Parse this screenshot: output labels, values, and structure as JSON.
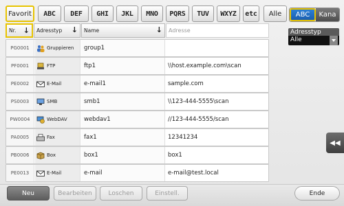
{
  "filter": {
    "tabs": [
      "Favorit",
      "ABC",
      "DEF",
      "GHI",
      "JKL",
      "MNO",
      "PQRS",
      "TUV",
      "WXYZ",
      "etc",
      "Alle"
    ],
    "active_tab": "Favorit"
  },
  "mode_toggle": {
    "abc": "ABC",
    "kana": "Kana",
    "selected": "ABC"
  },
  "address_type_filter": {
    "label": "Adresstyp",
    "value": "Alle"
  },
  "table": {
    "columns": {
      "nr": "Nr.",
      "type": "Adresstyp",
      "name": "Name",
      "address": "Adresse"
    },
    "rows": [
      {
        "nr": "PG0001",
        "type": "Gruppieren",
        "icon": "group-icon",
        "name": "group1",
        "address": ""
      },
      {
        "nr": "PF0001",
        "type": "FTP",
        "icon": "ftp-icon",
        "name": "ftp1",
        "address": "\\\\host.example.com\\scan"
      },
      {
        "nr": "PE0002",
        "type": "E-Mail",
        "icon": "email-icon",
        "name": "e-mail1",
        "address": "sample.com"
      },
      {
        "nr": "PS0003",
        "type": "SMB",
        "icon": "smb-icon",
        "name": "smb1",
        "address": "\\\\123-444-5555\\scan"
      },
      {
        "nr": "PW0004",
        "type": "WebDAV",
        "icon": "webdav-icon",
        "name": "webdav1",
        "address": "//123-444-5555/scan"
      },
      {
        "nr": "PA0005",
        "type": "Fax",
        "icon": "fax-icon",
        "name": "fax1",
        "address": "12341234"
      },
      {
        "nr": "PB0006",
        "type": "Box",
        "icon": "box-icon",
        "name": "box1",
        "address": "box1"
      },
      {
        "nr": "PE0013",
        "type": "E-Mail",
        "icon": "email-icon",
        "name": "e-mail",
        "address": "e-mail@test.local"
      }
    ]
  },
  "buttons": {
    "new": "Neu",
    "edit": "Bearbeiten",
    "delete": "Loschen",
    "settings": "Einstell.",
    "end": "Ende"
  },
  "colors": {
    "highlight": "#e7c300",
    "accent_blue": "#1a5faf"
  }
}
